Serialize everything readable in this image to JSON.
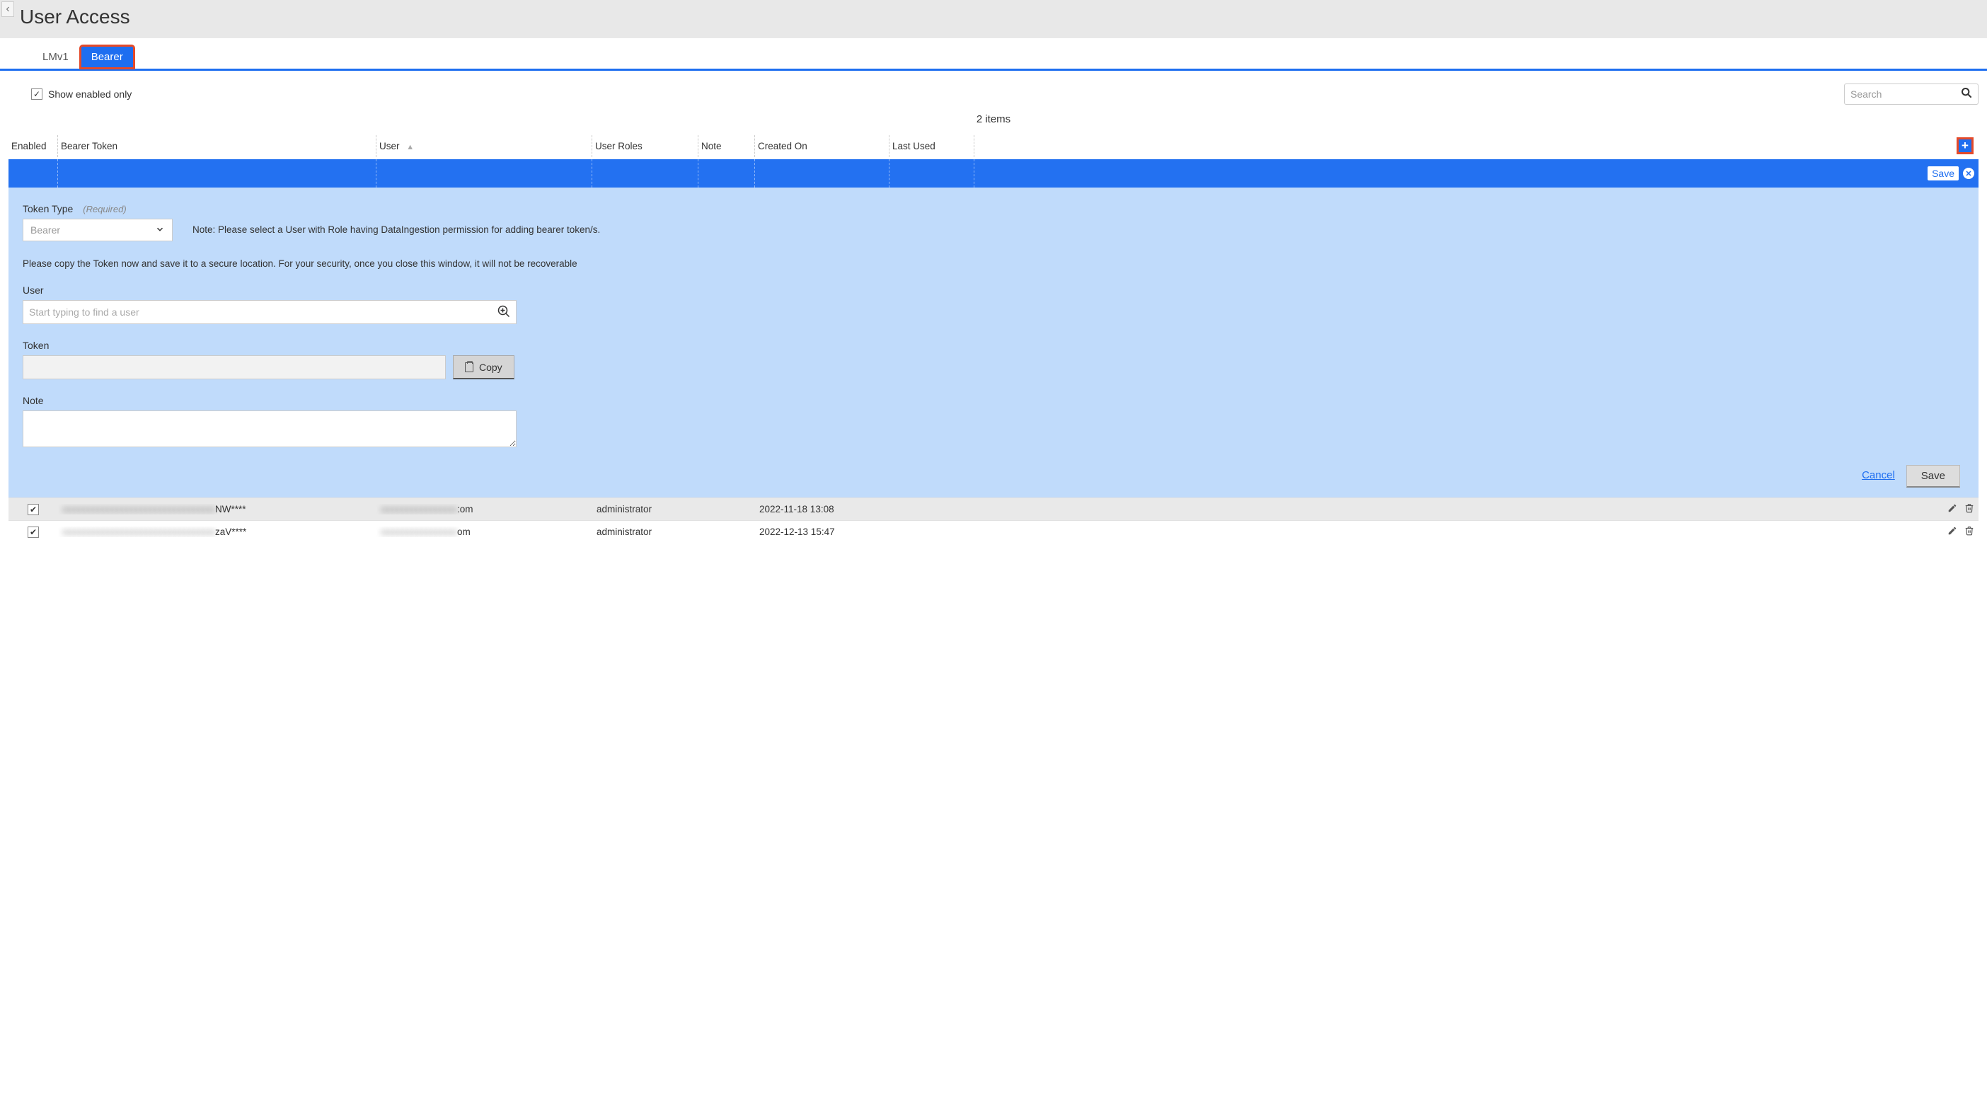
{
  "header": {
    "title": "User Access"
  },
  "tabs": {
    "lmv1": "LMv1",
    "bearer": "Bearer"
  },
  "filter": {
    "show_enabled_only": "Show enabled only",
    "search_placeholder": "Search"
  },
  "count_label": "2 items",
  "columns": {
    "enabled": "Enabled",
    "bearer_token": "Bearer Token",
    "user": "User",
    "user_roles": "User Roles",
    "note": "Note",
    "created_on": "Created On",
    "last_used": "Last Used"
  },
  "row_actions": {
    "save_chip": "Save"
  },
  "form": {
    "token_type_label": "Token Type",
    "required_hint": "(Required)",
    "token_type_value": "Bearer",
    "helper_note": "Note: Please select a User with Role having DataIngestion permission for adding bearer token/s.",
    "security_warning": "Please copy the Token now and save it to a secure location. For your security, once you close this window, it will not be recoverable",
    "user_label": "User",
    "user_placeholder": "Start typing to find a user",
    "token_label": "Token",
    "copy_label": "Copy",
    "note_label": "Note",
    "cancel_label": "Cancel",
    "save_label": "Save"
  },
  "rows": [
    {
      "bearer_token_suffix": "NW****",
      "user_suffix": ":om",
      "user_roles": "administrator",
      "note": "",
      "created_on": "2022-11-18 13:08",
      "last_used": ""
    },
    {
      "bearer_token_suffix": "zaV****",
      "user_suffix": "om",
      "user_roles": "administrator",
      "note": "",
      "created_on": "2022-12-13 15:47",
      "last_used": ""
    }
  ]
}
